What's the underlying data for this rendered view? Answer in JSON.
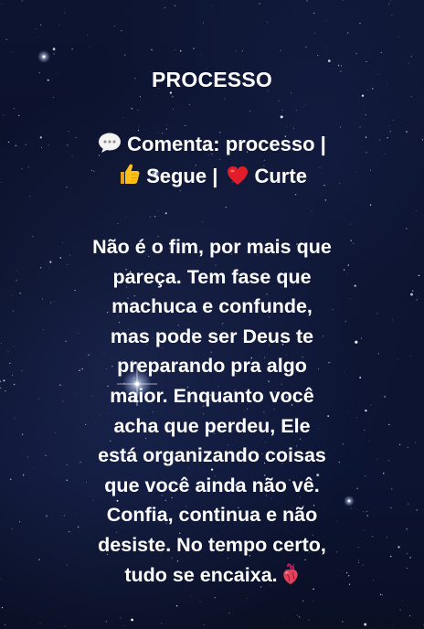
{
  "post": {
    "title": "PROCESSO",
    "cta": {
      "comment_icon": "speech-bubble-icon",
      "comment_text": "Comenta: processo |",
      "follow_icon": "thumbs-up-icon",
      "follow_text": "Segue |",
      "like_icon": "red-heart-icon",
      "like_text": "Curte"
    },
    "message_lines": [
      "Não é o fim, por mais que",
      "pareça. Tem fase que",
      "machuca e confunde,",
      "mas pode ser Deus te",
      "preparando pra algo",
      "maior. Enquanto você",
      "acha que perdeu, Ele",
      "está organizando coisas",
      "que você ainda não vê.",
      "Confia, continua e não",
      "desiste. No tempo certo,",
      "tudo se encaixa."
    ],
    "end_icon": "anatomical-heart-icon"
  },
  "colors": {
    "background": "#0b1026",
    "text": "#ffffff",
    "heart": "#e11d2a"
  }
}
